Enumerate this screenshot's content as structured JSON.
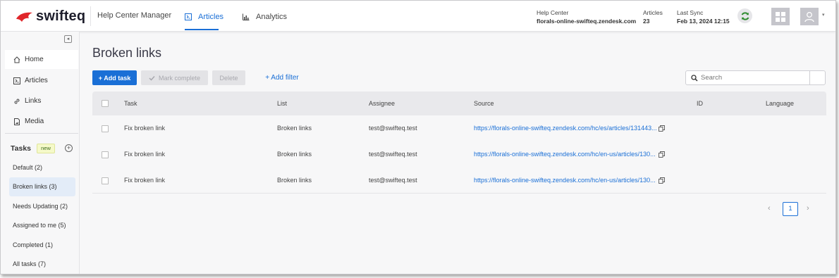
{
  "brand": {
    "name": "swifteq",
    "accent": "#1a6fd6",
    "logo_color": "#e0262a"
  },
  "header": {
    "app_name": "Help Center Manager",
    "tabs": [
      {
        "label": "Articles",
        "icon": "article-icon",
        "active": true
      },
      {
        "label": "Analytics",
        "icon": "bar-chart-icon",
        "active": false
      }
    ],
    "help_center_label": "Help Center",
    "help_center_value": "florals-online-swifteq.zendesk.com",
    "articles_label": "Articles",
    "articles_value": "23",
    "last_sync_label": "Last Sync",
    "last_sync_value": "Feb 13, 2024 12:15",
    "icons": [
      "sync-icon",
      "grid-icon",
      "user-icon",
      "caret-down-icon"
    ]
  },
  "sidebar": {
    "nav": [
      {
        "label": "Home",
        "icon": "home-icon"
      },
      {
        "label": "Articles",
        "icon": "article-icon"
      },
      {
        "label": "Links",
        "icon": "link-icon"
      },
      {
        "label": "Media",
        "icon": "media-icon"
      }
    ],
    "tasks_title": "Tasks",
    "new_badge": "new",
    "task_lists": [
      {
        "label": "Default (2)",
        "active": false
      },
      {
        "label": "Broken links (3)",
        "active": true
      },
      {
        "label": "Needs Updating (2)",
        "active": false
      },
      {
        "label": "Assigned to me (5)",
        "active": false
      },
      {
        "label": "Completed (1)",
        "active": false
      },
      {
        "label": "All tasks (7)",
        "active": false
      }
    ]
  },
  "main": {
    "title": "Broken links",
    "toolbar": {
      "add_task": "+ Add task",
      "mark_complete": "Mark complete",
      "delete": "Delete",
      "add_filter": "+ Add filter"
    },
    "search": {
      "placeholder": "Search",
      "value": ""
    },
    "table": {
      "columns": [
        "Task",
        "List",
        "Assignee",
        "Source",
        "ID",
        "Language"
      ],
      "rows": [
        {
          "task": "Fix broken link",
          "list": "Broken links",
          "assignee": "test@swifteq.test",
          "source": "https://florals-online-swifteq.zendesk.com/hc/es/articles/131443...",
          "id": "",
          "language": ""
        },
        {
          "task": "Fix broken link",
          "list": "Broken links",
          "assignee": "test@swifteq.test",
          "source": "https://florals-online-swifteq.zendesk.com/hc/en-us/articles/130...",
          "id": "",
          "language": ""
        },
        {
          "task": "Fix broken link",
          "list": "Broken links",
          "assignee": "test@swifteq.test",
          "source": "https://florals-online-swifteq.zendesk.com/hc/en-us/articles/130...",
          "id": "",
          "language": ""
        }
      ]
    },
    "pagination": {
      "prev": "‹",
      "current": "1",
      "next": "›"
    }
  }
}
